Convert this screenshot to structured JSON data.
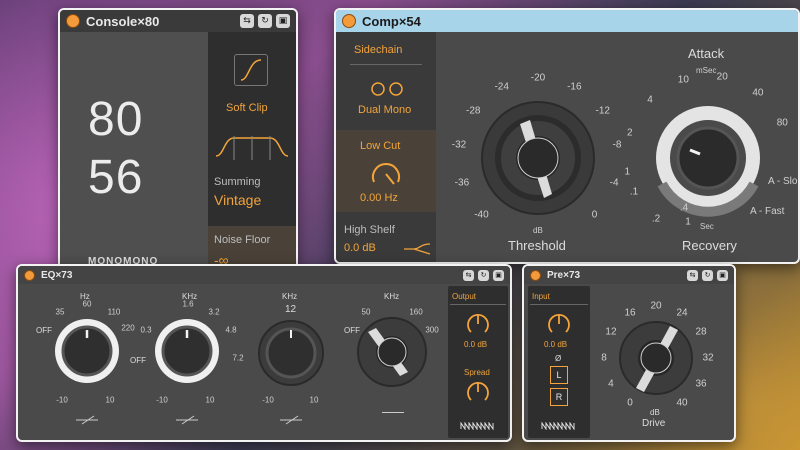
{
  "console": {
    "title": "Console×80",
    "value_top": "80",
    "value_bottom": "56",
    "mode_label": "MONOMONO",
    "soft_clip": "Soft Clip",
    "summing_label": "Summing",
    "summing_value": "Vintage",
    "noise_floor_label": "Noise Floor",
    "noise_floor_value": "-∞"
  },
  "comp": {
    "title": "Comp×54",
    "sidechain_label": "Sidechain",
    "dual_mono": "Dual Mono",
    "low_cut_label": "Low Cut",
    "low_cut_value": "0.00 Hz",
    "high_shelf_label": "High Shelf",
    "high_shelf_value": "0.0 dB",
    "threshold_label": "Threshold",
    "threshold_unit": "dB",
    "threshold_ticks": [
      "-40",
      "-36",
      "-32",
      "-28",
      "-24",
      "-20",
      "-16",
      "-12",
      "-8",
      "-4",
      "0"
    ],
    "attack_label": "Attack",
    "attack_unit": "mSec",
    "attack_ticks": [
      "1",
      "2",
      "4",
      "10",
      "20",
      "40",
      "80"
    ],
    "recovery_label": "Recovery",
    "recovery_unit": "Sec",
    "recovery_ticks": [
      ".1",
      ".2",
      ".4",
      "1"
    ],
    "auto_slow": "A - Slo",
    "auto_fast": "A - Fast"
  },
  "eq": {
    "title": "EQ×73",
    "band1": {
      "unit": "Hz",
      "off": "OFF",
      "ticks": [
        "35",
        "60",
        "110",
        "220"
      ]
    },
    "band2": {
      "unit": "KHz",
      "off": "OFF",
      "ticks": [
        "0.3",
        "1.6",
        "3.2",
        "4.8",
        "7.2"
      ]
    },
    "band3": {
      "unit": "KHz",
      "top": "12"
    },
    "band4": {
      "unit": "KHz",
      "off": "OFF",
      "ticks": [
        "50",
        "160",
        "300"
      ]
    },
    "gain_ticks": [
      "-10",
      "10"
    ],
    "output_label": "Output",
    "output_value": "0.0 dB",
    "spread_label": "Spread"
  },
  "pre": {
    "title": "Pre×73",
    "input_label": "Input",
    "input_value": "0.0 dB",
    "phase_symbol": "Ø",
    "left": "L",
    "right": "R",
    "drive_label": "Drive",
    "drive_unit": "dB",
    "drive_ticks": [
      "0",
      "4",
      "8",
      "12",
      "16",
      "20",
      "24",
      "28",
      "32",
      "36",
      "40"
    ]
  },
  "colors": {
    "accent": "#f3a43a",
    "panel": "#4a4a4a",
    "dark_panel": "#3a3a3a",
    "title_light": "#a8d4ea"
  }
}
